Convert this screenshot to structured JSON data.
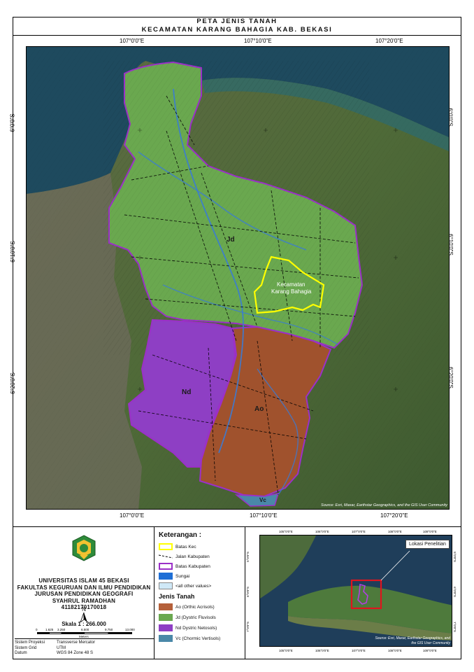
{
  "title": {
    "line1": "PETA JENIS TANAH",
    "line2": "KECAMATAN KARANG BAHAGIA KAB. BEKASI"
  },
  "map": {
    "grid_top": [
      "107°0'0\"E",
      "107°10'0\"E",
      "107°20'0\"E"
    ],
    "grid_bottom": [
      "107°0'0\"E",
      "107°10'0\"E",
      "107°20'0\"E"
    ],
    "grid_left": [
      "6°0'0\"S",
      "6°10'0\"S",
      "6°20'0\"S"
    ],
    "grid_right": [
      "6°0'0\"S",
      "6°10'0\"S",
      "6°20'0\"S"
    ],
    "labels": {
      "jd": "Jd",
      "nd": "Nd",
      "ao": "Ao",
      "vc": "Vc",
      "kec_line1": "Kecamatan",
      "kec_line2": "Karang Bahagia"
    },
    "credit": "Source: Esri, Maxar, Earthstar Geographics, and the GIS User Community",
    "colors": {
      "jd": "#6aa84f",
      "nd": "#8e3fc4",
      "ao": "#a0522d",
      "kec_outline": "#ffff00",
      "kab_outline": "#9b30c8",
      "river": "#3a7bd5"
    }
  },
  "institution": {
    "line1": "UNIVERSITAS ISLAM 45 BEKASI",
    "line2": "FAKULTAS KEGURUAN DAN ILMU PENDIDIKAN",
    "line3": "JURUSAN PENDIDIKAN GEOGRAFI",
    "line4": "SYAHRUL RAMADHAN",
    "line5": "41182170170018"
  },
  "north": "N",
  "scale": {
    "label": "Skala 1 : 266.000",
    "ticks": [
      "0",
      "1.625",
      "3.250",
      "6.500",
      "9.750",
      "13.000"
    ],
    "unit": "Meters"
  },
  "projection": {
    "rows": [
      {
        "k": "Sistem Proyeksi",
        "v": "Transverse Mercator"
      },
      {
        "k": "Sistem Grid",
        "v": "UTM"
      },
      {
        "k": "Datum",
        "v": "WGS 84 Zone 48 S"
      }
    ]
  },
  "legend": {
    "title": "Keterangan :",
    "items": [
      {
        "label": "Batas Kec"
      },
      {
        "label": "Jalan Kabupaten"
      },
      {
        "label": "Batas Kabupaten"
      },
      {
        "label": "Sungai"
      },
      {
        "label": "<all other values>"
      }
    ],
    "soil_title": "Jenis Tanah",
    "soils": [
      {
        "label": "Ao (Orthic Acrisols)",
        "color": "#b5603a"
      },
      {
        "label": "Jd (Dystric Fluvisols",
        "color": "#6aa84f"
      },
      {
        "label": "Nd Dystric Netosols)",
        "color": "#8e3fc4"
      },
      {
        "label": "Vc (Chormic Vertisols)",
        "color": "#4a88a8"
      }
    ]
  },
  "inset": {
    "label": "Lokasi Penelitian",
    "top": [
      "105°0'0\"E",
      "106°0'0\"E",
      "107°0'0\"E",
      "108°0'0\"E",
      "109°0'0\"E"
    ],
    "bottom": [
      "105°0'0\"E",
      "106°0'0\"E",
      "107°0'0\"E",
      "108°0'0\"E",
      "109°0'0\"E"
    ],
    "left": [
      "5°0'0\"S",
      "6°0'0\"S",
      "7°0'0\"S"
    ],
    "right": [
      "5°0'0\"S",
      "6°0'0\"S",
      "7°0'0\"S"
    ],
    "credit_line1": "Source: Esri, Maxar, Earthstar Geographics, and",
    "credit_line2": "the GIS User Community"
  }
}
